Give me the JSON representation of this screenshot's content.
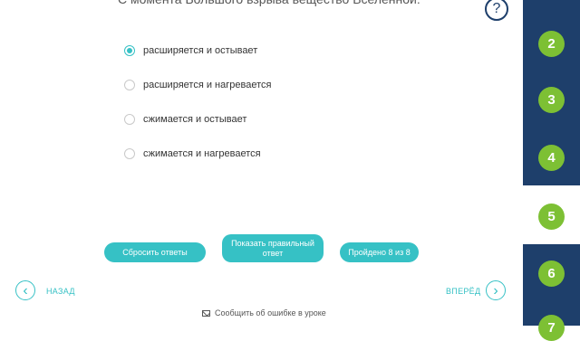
{
  "question": {
    "text": "С момента Большого взрыва вещество Вселенной:"
  },
  "help_label": "?",
  "options": [
    {
      "label": "расширяется и остывает",
      "selected": true
    },
    {
      "label": "расширяется и нагревается",
      "selected": false
    },
    {
      "label": "сжимается и остывает",
      "selected": false
    },
    {
      "label": "сжимается и нагревается",
      "selected": false
    }
  ],
  "buttons": {
    "reset": "Сбросить ответы",
    "show_answer": "Показать правильный ответ",
    "progress": "Пройдено 8 из 8"
  },
  "nav": {
    "back": "НАЗАД",
    "next": "ВПЕРЁД",
    "back_icon": "‹",
    "next_icon": "›"
  },
  "report": "Сообщить об ошибке в уроке",
  "steps": [
    "2",
    "3",
    "4",
    "5",
    "6",
    "7"
  ],
  "current_step": "5",
  "colors": {
    "accent": "#36c1c5",
    "sidebar": "#1e3f6b",
    "step": "#7dc034"
  },
  "icons": {
    "help": "question-circle-icon",
    "back": "chevron-left-icon",
    "next": "chevron-right-icon",
    "report": "envelope-icon"
  }
}
